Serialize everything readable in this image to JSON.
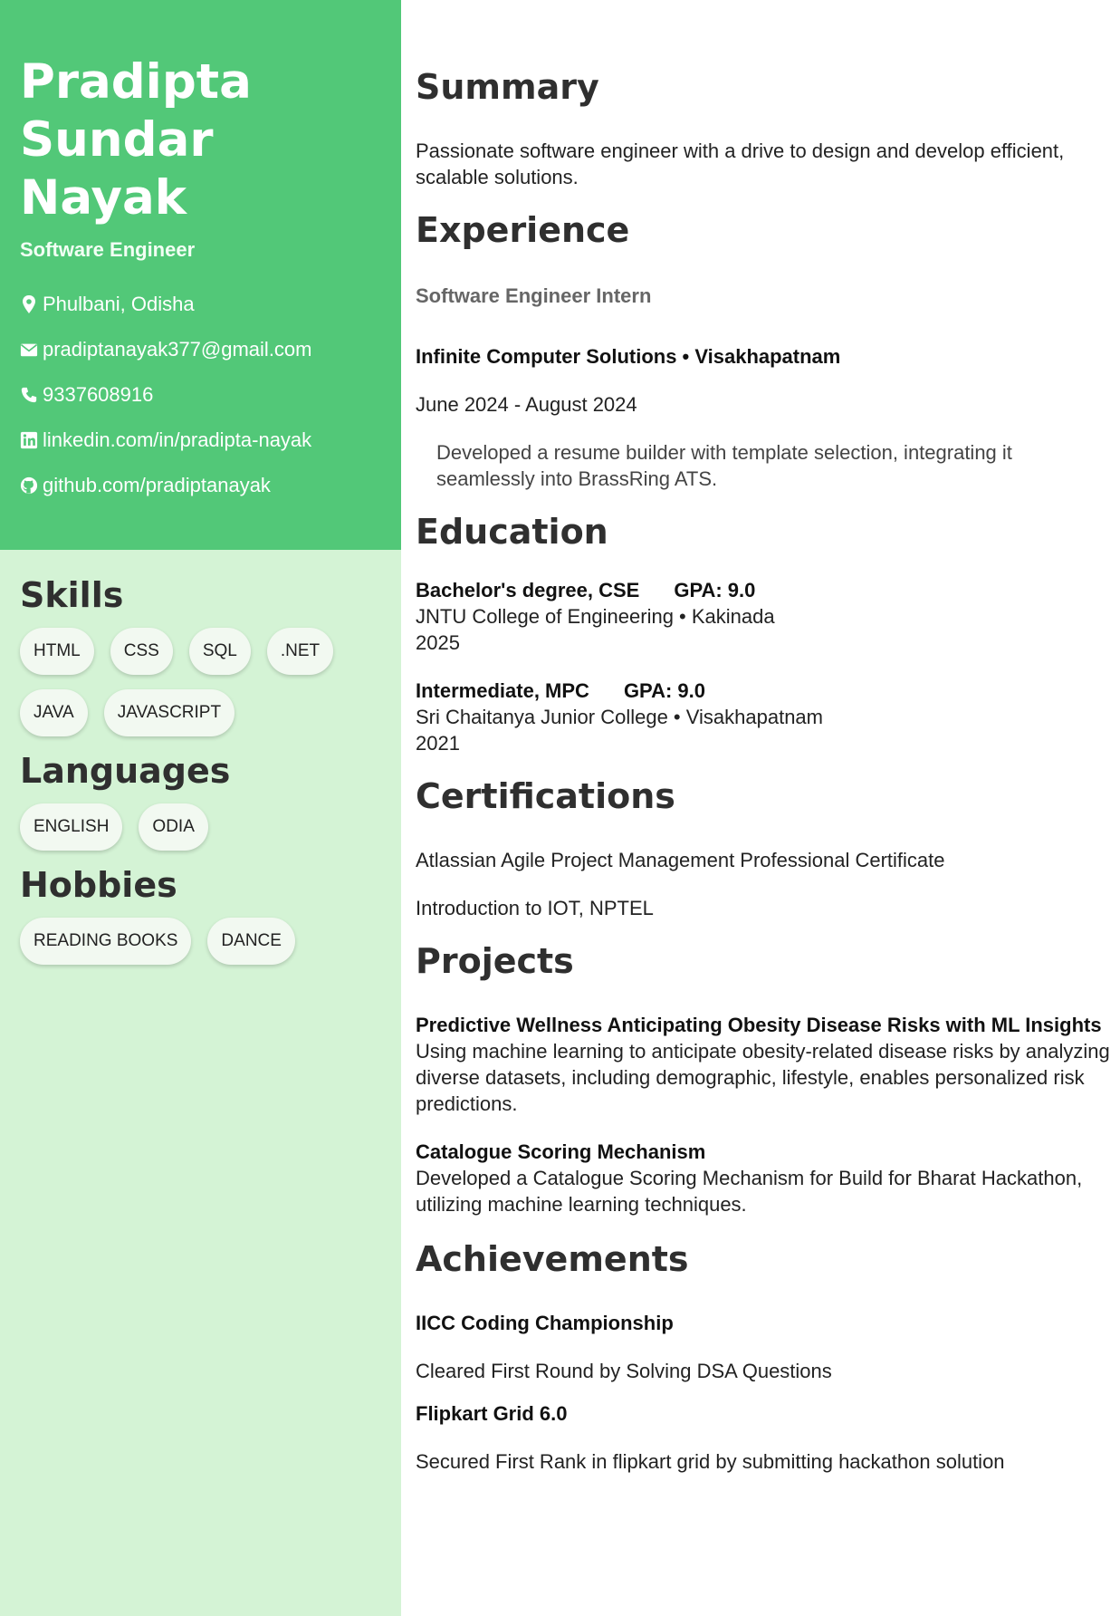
{
  "profile": {
    "name_line1": "Pradipta",
    "name_line2": "Sundar",
    "name_line3": "Nayak",
    "title": "Software Engineer"
  },
  "contact": {
    "location": "Phulbani, Odisha",
    "email": "pradiptanayak377@gmail.com",
    "phone": "9337608916",
    "linkedin": "linkedin.com/in/pradipta-nayak",
    "github": "github.com/pradiptanayak"
  },
  "skills": {
    "heading": "Skills",
    "items": [
      "HTML",
      "CSS",
      "SQL",
      ".NET",
      "JAVA",
      "JAVASCRIPT"
    ]
  },
  "languages": {
    "heading": "Languages",
    "items": [
      "ENGLISH",
      "ODIA"
    ]
  },
  "hobbies": {
    "heading": "Hobbies",
    "items": [
      "READING BOOKS",
      "DANCE"
    ]
  },
  "summary": {
    "heading": "Summary",
    "text": "Passionate software engineer with a drive to design and develop efficient, scalable solutions."
  },
  "experience": {
    "heading": "Experience",
    "role": "Software Engineer Intern",
    "company": "Infinite Computer Solutions • Visakhapatnam",
    "dates": "June 2024 - August 2024",
    "description": "Developed a resume builder with template selection, integrating it seamlessly into BrassRing ATS."
  },
  "education": {
    "heading": "Education",
    "items": [
      {
        "degree": "Bachelor's degree, CSE",
        "gpa": "GPA: 9.0",
        "school": "JNTU College of Engineering • Kakinada",
        "year": "2025"
      },
      {
        "degree": "Intermediate, MPC",
        "gpa": "GPA: 9.0",
        "school": "Sri Chaitanya Junior College • Visakhapatnam",
        "year": "2021"
      }
    ]
  },
  "certifications": {
    "heading": "Certifications",
    "items": [
      "Atlassian Agile Project Management Professional Certificate",
      "Introduction to IOT, NPTEL"
    ]
  },
  "projects": {
    "heading": "Projects",
    "items": [
      {
        "title": "Predictive Wellness Anticipating Obesity Disease Risks with ML Insights",
        "description": "Using machine learning to anticipate obesity-related disease risks by analyzing diverse datasets, including demographic, lifestyle, enables personalized risk predictions."
      },
      {
        "title": "Catalogue Scoring Mechanism",
        "description": "Developed a Catalogue Scoring Mechanism for Build for Bharat Hackathon, utilizing machine learning techniques."
      }
    ]
  },
  "achievements": {
    "heading": "Achievements",
    "items": [
      {
        "title": "IICC Coding Championship",
        "description": "Cleared First Round by Solving DSA Questions"
      },
      {
        "title": "Flipkart Grid 6.0",
        "description": "Secured First Rank in flipkart grid by submitting hackathon solution"
      }
    ]
  }
}
